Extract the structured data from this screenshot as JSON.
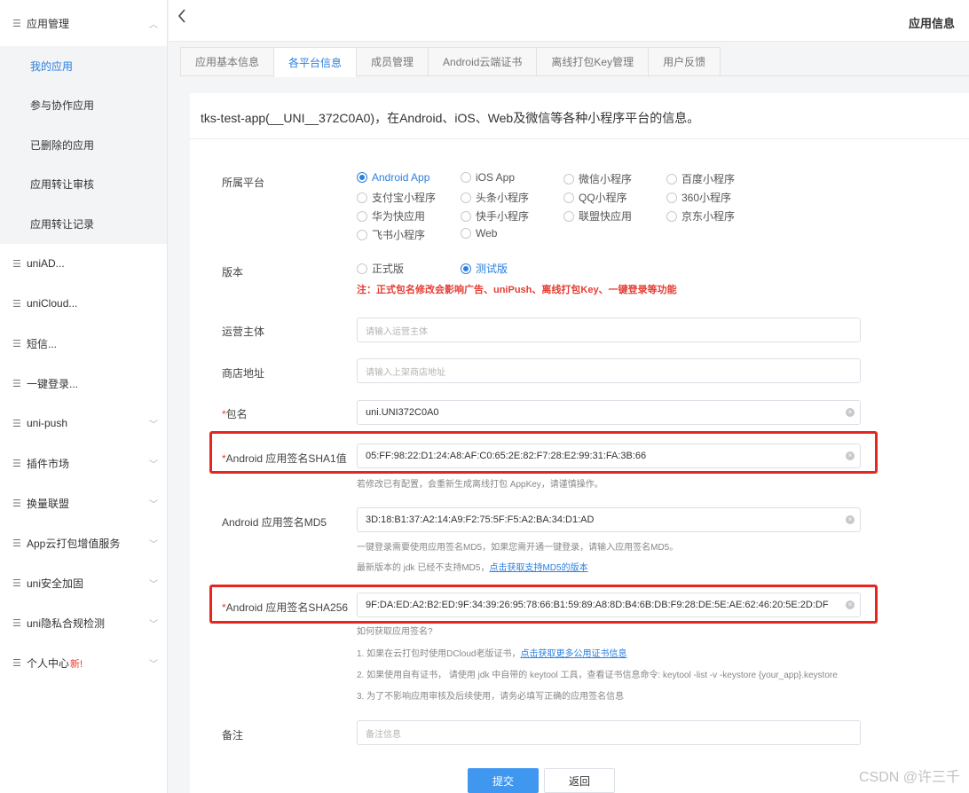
{
  "sidebar": {
    "group": {
      "label": "应用管理",
      "icon": "menu-lines-icon",
      "expanded": true
    },
    "sub_items": [
      "我的应用",
      "参与协作应用",
      "已删除的应用",
      "应用转让审核",
      "应用转让记录"
    ],
    "items": [
      {
        "label": "uniAD...",
        "has_chevron": false
      },
      {
        "label": "uniCloud...",
        "has_chevron": false
      },
      {
        "label": "短信...",
        "has_chevron": false
      },
      {
        "label": "一键登录...",
        "has_chevron": false
      },
      {
        "label": "uni-push",
        "has_chevron": true
      },
      {
        "label": "插件市场",
        "has_chevron": true
      },
      {
        "label": "换量联盟",
        "has_chevron": true
      },
      {
        "label": "App云打包增值服务",
        "has_chevron": true
      },
      {
        "label": "uni安全加固",
        "has_chevron": true
      },
      {
        "label": "uni隐私合规检测",
        "has_chevron": true
      },
      {
        "label": "个人中心",
        "badge": "新!",
        "has_chevron": true
      }
    ]
  },
  "header": {
    "back_icon": "chevron-left-icon",
    "title": "应用信息"
  },
  "tabs": [
    {
      "label": "应用基本信息",
      "active": false
    },
    {
      "label": "各平台信息",
      "active": true
    },
    {
      "label": "成员管理",
      "active": false
    },
    {
      "label": "Android云端证书",
      "active": false
    },
    {
      "label": "离线打包Key管理",
      "active": false
    },
    {
      "label": "用户反馈",
      "active": false
    }
  ],
  "main": {
    "title": "tks-test-app(__UNI__372C0A0)，在Android、iOS、Web及微信等各种小程序平台的信息。",
    "platform": {
      "label": "所属平台",
      "options": [
        "Android App",
        "iOS App",
        "微信小程序",
        "百度小程序",
        "支付宝小程序",
        "头条小程序",
        "QQ小程序",
        "360小程序",
        "华为快应用",
        "快手小程序",
        "联盟快应用",
        "京东小程序",
        "飞书小程序",
        "Web"
      ],
      "selected": "Android App"
    },
    "version": {
      "label": "版本",
      "options": [
        "正式版",
        "测试版"
      ],
      "selected": "测试版",
      "warning": "注：正式包名修改会影响广告、uniPush、离线打包Key、一键登录等功能"
    },
    "operator": {
      "label": "运营主体",
      "placeholder": "请输入运营主体",
      "value": ""
    },
    "store_url": {
      "label": "商店地址",
      "placeholder": "请输入上架商店地址",
      "value": ""
    },
    "package": {
      "required_mark": "*",
      "label": "包名",
      "value": "uni.UNI372C0A0"
    },
    "sha1": {
      "required_mark": "*",
      "label": "Android 应用签名SHA1值",
      "value": "05:FF:98:22:D1:24:A8:AF:C0:65:2E:82:F7:28:E2:99:31:FA:3B:66",
      "hint": "若修改已有配置，会重新生成离线打包 AppKey，请谨慎操作。"
    },
    "md5": {
      "label": "Android 应用签名MD5",
      "value": "3D:18:B1:37:A2:14:A9:F2:75:5F:F5:A2:BA:34:D1:AD",
      "hint1": "一键登录需要使用应用签名MD5，如果您需开通一键登录，请输入应用签名MD5。",
      "hint2_text": "最新版本的 jdk 已经不支持MD5，",
      "hint2_link": "点击获取支持MD5的版本"
    },
    "sha256": {
      "required_mark": "*",
      "label": "Android 应用签名SHA256",
      "value": "9F:DA:ED:A2:B2:ED:9F:34:39:26:95:78:66:B1:59:89:A8:8D:B4:6B:DB:F9:28:DE:5E:AE:62:46:20:5E:2D:DF",
      "help_title": "如何获取应用签名?",
      "help1_text": "1. 如果在云打包时使用DCloud老版证书，",
      "help1_link": "点击获取更多公用证书信息",
      "help2": "2. 如果使用自有证书， 请使用 jdk 中自带的 keytool 工具，查看证书信息命令: keytool -list -v -keystore {your_app}.keystore",
      "help3": "3. 为了不影响应用审核及后续使用，请务必填写正确的应用签名信息"
    },
    "remark": {
      "label": "备注",
      "placeholder": "备注信息",
      "value": ""
    },
    "actions": {
      "submit": "提交",
      "back": "返回"
    }
  },
  "watermark": "CSDN @许三千",
  "colors": {
    "primary": "#2b7fe0",
    "danger": "#e43d33",
    "highlight_box": "#e5261f"
  }
}
